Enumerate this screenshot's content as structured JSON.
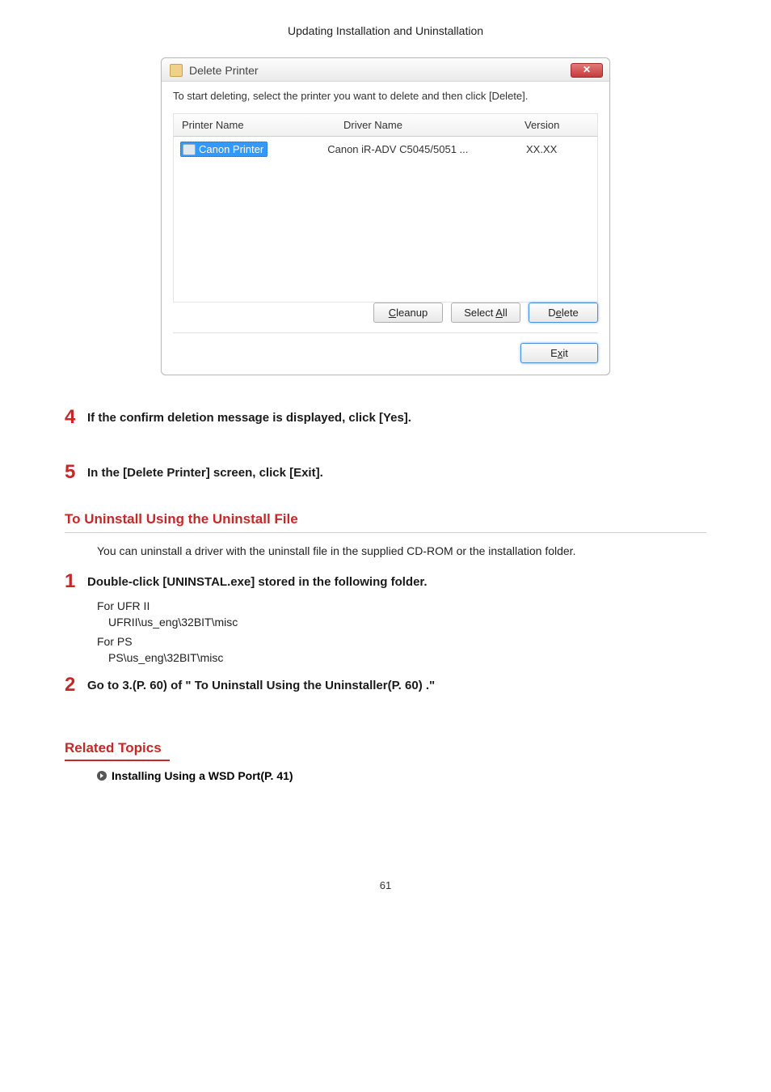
{
  "chapter_title": "Updating Installation and Uninstallation",
  "dialog": {
    "title": "Delete Printer",
    "close_glyph": "✕",
    "instruction": "To start deleting, select the printer you want to delete and then click [Delete].",
    "columns": {
      "printer": "Printer Name",
      "driver": "Driver Name",
      "version": "Version"
    },
    "row": {
      "printer": "Canon Printer",
      "driver": "Canon iR-ADV C5045/5051 ...",
      "version": "XX.XX"
    },
    "buttons": {
      "cleanup_prefix": "C",
      "cleanup_rest": "leanup",
      "selectall_prefix": "Select ",
      "selectall_mnemonic": "A",
      "selectall_suffix": "ll",
      "delete_prefix": "D",
      "delete_mnemonic": "e",
      "delete_suffix": "lete",
      "exit_prefix": "E",
      "exit_mnemonic": "x",
      "exit_suffix": "it"
    }
  },
  "steps_a": {
    "s4": "If the confirm deletion message is displayed, click [Yes].",
    "s5": "In the [Delete Printer] screen, click [Exit]."
  },
  "section_h": "To Uninstall Using the Uninstall File",
  "section_p": "You can uninstall a driver with the uninstall file in the supplied CD-ROM or the installation folder.",
  "steps_b": {
    "s1": "Double-click [UNINSTAL.exe] stored in the following folder.",
    "s2_pre": "Go to ",
    "s2_link1": "3.(P. 60)",
    "s2_mid": " of \" ",
    "s2_link2": "To Uninstall Using the Uninstaller(P. 60)",
    "s2_post": " .\""
  },
  "paths": {
    "ufr_label": "For UFR II",
    "ufr_path": "UFRII\\us_eng\\32BIT\\misc",
    "ps_label": "For PS",
    "ps_path": "PS\\us_eng\\32BIT\\misc"
  },
  "related": {
    "heading": "Related Topics",
    "link": "Installing Using a WSD Port(P. 41)"
  },
  "page_number": "61"
}
